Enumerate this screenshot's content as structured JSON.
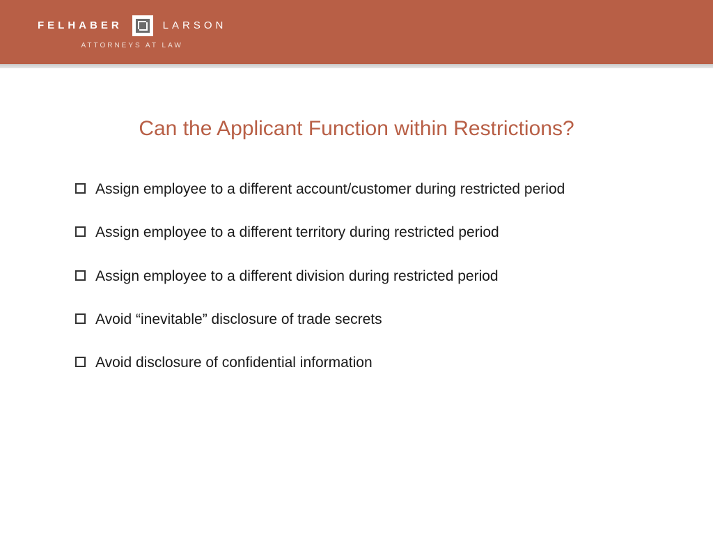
{
  "header": {
    "brand_left": "FELHABER",
    "brand_right": "LARSON",
    "tagline": "ATTORNEYS AT LAW"
  },
  "slide": {
    "title": "Can the Applicant Function within Restrictions?",
    "bullets": [
      "Assign employee to a different account/customer during restricted period",
      "Assign employee to a different territory during restricted period",
      "Assign employee to a different division during restricted period",
      "Avoid “inevitable” disclosure of trade secrets",
      "Avoid disclosure of confidential information"
    ]
  }
}
